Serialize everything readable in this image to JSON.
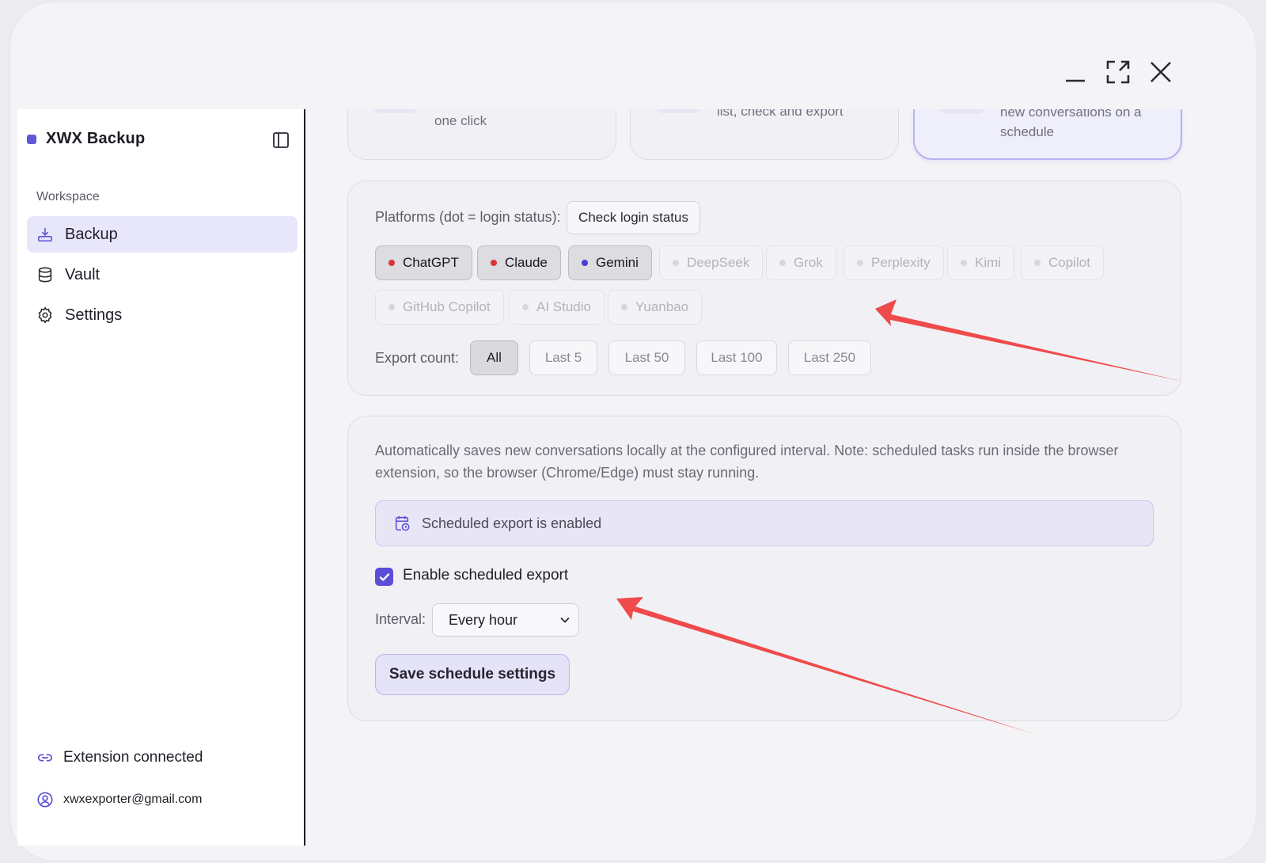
{
  "window": {
    "controls": [
      "minimize-icon",
      "expand-icon",
      "close-icon"
    ]
  },
  "sidebar": {
    "brand": "XWX Backup",
    "section": "Workspace",
    "items": [
      {
        "label": "Backup",
        "icon": "download-icon",
        "active": true
      },
      {
        "label": "Vault",
        "icon": "database-icon",
        "active": false
      },
      {
        "label": "Settings",
        "icon": "gear-icon",
        "active": false
      }
    ],
    "footer": {
      "connection": "Extension connected",
      "account": "xwxexporter@gmail.com"
    }
  },
  "mode_cards": [
    {
      "text": "one click"
    },
    {
      "text": "list, check and export"
    },
    {
      "text": "new conversations on a schedule",
      "selected": true
    }
  ],
  "platforms": {
    "label": "Platforms (dot = login status):",
    "check_button": "Check login status",
    "chips": [
      {
        "name": "ChatGPT",
        "enabled": true,
        "dot_color": "#d8343a"
      },
      {
        "name": "Claude",
        "enabled": true,
        "dot_color": "#d8343a"
      },
      {
        "name": "Gemini",
        "enabled": true,
        "dot_color": "#4a3fd8"
      },
      {
        "name": "DeepSeek",
        "enabled": false
      },
      {
        "name": "Grok",
        "enabled": false
      },
      {
        "name": "Perplexity",
        "enabled": false
      },
      {
        "name": "Kimi",
        "enabled": false
      },
      {
        "name": "Copilot",
        "enabled": false
      },
      {
        "name": "GitHub Copilot",
        "enabled": false
      },
      {
        "name": "AI Studio",
        "enabled": false
      },
      {
        "name": "Yuanbao",
        "enabled": false
      }
    ]
  },
  "export_count": {
    "label": "Export count:",
    "options": [
      "All",
      "Last 5",
      "Last 50",
      "Last 100",
      "Last 250"
    ],
    "selected": "All"
  },
  "schedule": {
    "description": "Automatically saves new conversations locally at the configured interval. Note: scheduled tasks run inside the browser extension, so the browser (Chrome/Edge) must stay running.",
    "status": "Scheduled export is enabled",
    "enable_label": "Enable scheduled export",
    "enabled": true,
    "interval_label": "Interval:",
    "interval_value": "Every hour",
    "save_button": "Save schedule settings"
  },
  "colors": {
    "accent": "#5a4ed6",
    "annotation_arrow": "#ef4b4b"
  }
}
